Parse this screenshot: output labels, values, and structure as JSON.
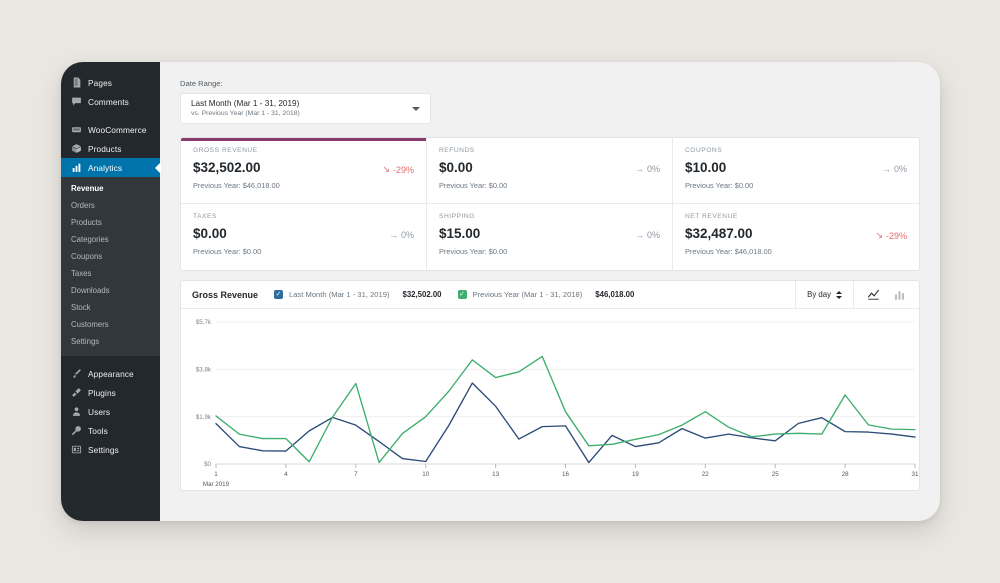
{
  "sidebar": {
    "primary": [
      {
        "label": "Pages",
        "icon": "page-icon"
      },
      {
        "label": "Comments",
        "icon": "comment-icon"
      }
    ],
    "secondary": [
      {
        "label": "WooCommerce",
        "icon": "storefront-icon"
      },
      {
        "label": "Products",
        "icon": "box-icon"
      },
      {
        "label": "Analytics",
        "icon": "chart-bars-icon",
        "active": true
      }
    ],
    "analytics_sub": [
      {
        "label": "Revenue",
        "current": true
      },
      {
        "label": "Orders"
      },
      {
        "label": "Products"
      },
      {
        "label": "Categories"
      },
      {
        "label": "Coupons"
      },
      {
        "label": "Taxes"
      },
      {
        "label": "Downloads"
      },
      {
        "label": "Stock"
      },
      {
        "label": "Customers"
      },
      {
        "label": "Settings"
      }
    ],
    "tertiary": [
      {
        "label": "Appearance",
        "icon": "brush-icon"
      },
      {
        "label": "Plugins",
        "icon": "plug-icon"
      },
      {
        "label": "Users",
        "icon": "user-icon"
      },
      {
        "label": "Tools",
        "icon": "wrench-icon"
      },
      {
        "label": "Settings",
        "icon": "sliders-icon"
      }
    ],
    "active_color": "#0073aa"
  },
  "date_range": {
    "label": "Date Range:",
    "primary": "Last Month (Mar 1 - 31, 2019)",
    "comparison": "vs. Previous Year (Mar 1 - 31, 2018)"
  },
  "stats": [
    {
      "title": "GROSS REVENUE",
      "value": "$32,502.00",
      "delta": "-29%",
      "delta_arrow": "↘",
      "delta_dir": "down",
      "previous": "Previous Year: $46,018.00",
      "selected": true
    },
    {
      "title": "REFUNDS",
      "value": "$0.00",
      "delta": "0%",
      "delta_arrow": "→",
      "delta_dir": "flat",
      "previous": "Previous Year: $0.00",
      "selected": false
    },
    {
      "title": "COUPONS",
      "value": "$10.00",
      "delta": "0%",
      "delta_arrow": "→",
      "delta_dir": "flat",
      "previous": "Previous Year: $0.00",
      "selected": false
    },
    {
      "title": "TAXES",
      "value": "$0.00",
      "delta": "0%",
      "delta_arrow": "→",
      "delta_dir": "flat",
      "previous": "Previous Year: $0.00",
      "selected": false
    },
    {
      "title": "SHIPPING",
      "value": "$15.00",
      "delta": "0%",
      "delta_arrow": "→",
      "delta_dir": "flat",
      "previous": "Previous Year: $0.00",
      "selected": false
    },
    {
      "title": "NET REVENUE",
      "value": "$32,487.00",
      "delta": "-29%",
      "delta_arrow": "↘",
      "delta_dir": "down",
      "previous": "Previous Year: $46,018.00",
      "selected": false
    }
  ],
  "chart_header": {
    "title": "Gross Revenue",
    "legend": [
      {
        "label": "Last Month (Mar 1 - 31, 2019)",
        "value": "$32,502.00",
        "color": "#2c6d9e",
        "checked": true
      },
      {
        "label": "Previous Year (Mar 1 - 31, 2018)",
        "value": "$46,018.00",
        "color": "#3eae6e",
        "checked": true
      }
    ],
    "interval": "By day",
    "view_line_icon": "line-chart-icon",
    "view_bar_icon": "bar-chart-icon",
    "active_view": "line"
  },
  "chart_data": {
    "type": "line",
    "title": "Gross Revenue",
    "xlabel": "Mar 2019",
    "ylabel": "",
    "ylim": [
      0,
      5700
    ],
    "ytick_labels": [
      "$5.7k",
      "$3.8k",
      "$1.9k",
      "$0"
    ],
    "ytick_values": [
      5700,
      3800,
      1900,
      0
    ],
    "xtick_labels": [
      "1",
      "4",
      "7",
      "10",
      "13",
      "16",
      "19",
      "22",
      "25",
      "28",
      "31"
    ],
    "x": [
      1,
      2,
      3,
      4,
      5,
      6,
      7,
      8,
      9,
      10,
      11,
      12,
      13,
      14,
      15,
      16,
      17,
      18,
      19,
      20,
      21,
      22,
      23,
      24,
      25,
      26,
      27,
      28,
      29,
      30,
      31
    ],
    "grid": true,
    "legend_position": "top",
    "series": [
      {
        "name": "Last Month (Mar 1 - 31, 2019)",
        "color": "#2c4b78",
        "values": [
          1620,
          700,
          530,
          520,
          1330,
          1870,
          1560,
          900,
          220,
          100,
          1560,
          3250,
          2320,
          1000,
          1500,
          1530,
          60,
          1150,
          700,
          850,
          1420,
          1040,
          1200,
          1050,
          930,
          1630,
          1860,
          1300,
          1280,
          1200,
          1080
        ]
      },
      {
        "name": "Previous Year (Mar 1 - 31, 2018)",
        "color": "#3eae6e",
        "values": [
          1930,
          1200,
          1020,
          1020,
          90,
          1880,
          3230,
          60,
          1220,
          1900,
          2930,
          4180,
          3470,
          3700,
          4320,
          2100,
          730,
          790,
          990,
          1180,
          1560,
          2100,
          1480,
          1090,
          1200,
          1230,
          1200,
          2770,
          1570,
          1400,
          1380
        ]
      }
    ]
  }
}
